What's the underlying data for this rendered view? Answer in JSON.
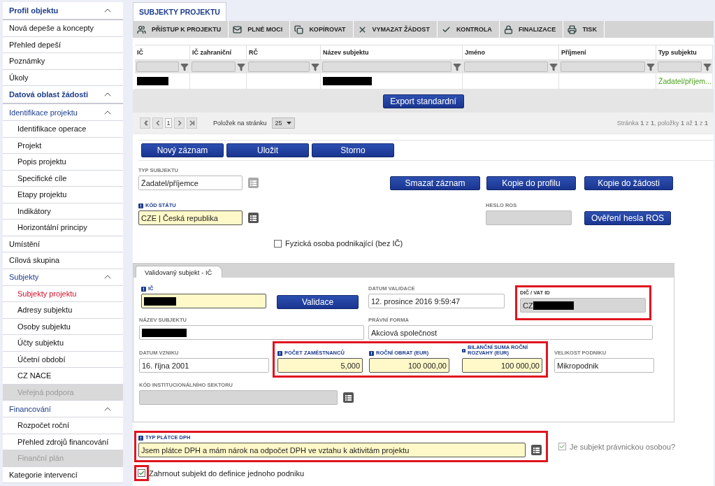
{
  "sidebar": {
    "items": [
      {
        "kind": "header",
        "label": "Profil objektu",
        "expanded": true
      },
      {
        "kind": "link",
        "label": "Nová depeše a koncepty",
        "selected": false,
        "disabled": false
      },
      {
        "kind": "link",
        "label": "Přehled depeší",
        "selected": false,
        "disabled": false
      },
      {
        "kind": "link",
        "label": "Poznámky",
        "selected": false,
        "disabled": false
      },
      {
        "kind": "link",
        "label": "Úkoly",
        "selected": false,
        "disabled": false
      },
      {
        "kind": "header",
        "label": "Datová oblast žádosti",
        "expanded": true
      },
      {
        "kind": "group",
        "label": "Identifikace projektu",
        "expanded": true,
        "children": [
          {
            "label": "Identifikace operace",
            "selected": false,
            "disabled": false
          },
          {
            "label": "Projekt",
            "selected": false,
            "disabled": false
          },
          {
            "label": "Popis projektu",
            "selected": false,
            "disabled": false
          },
          {
            "label": "Specifické cíle",
            "selected": false,
            "disabled": false
          },
          {
            "label": "Etapy projektu",
            "selected": false,
            "disabled": false
          },
          {
            "label": "Indikátory",
            "selected": false,
            "disabled": false
          },
          {
            "label": "Horizontální principy",
            "selected": false,
            "disabled": false
          }
        ]
      },
      {
        "kind": "link",
        "label": "Umístění",
        "selected": false,
        "disabled": false
      },
      {
        "kind": "link",
        "label": "Cílová skupina",
        "selected": false,
        "disabled": false
      },
      {
        "kind": "group",
        "label": "Subjekty",
        "expanded": true,
        "children": [
          {
            "label": "Subjekty projektu",
            "selected": true,
            "disabled": false
          },
          {
            "label": "Adresy subjektu",
            "selected": false,
            "disabled": false
          },
          {
            "label": "Osoby subjektu",
            "selected": false,
            "disabled": false
          },
          {
            "label": "Účty subjektu",
            "selected": false,
            "disabled": false
          },
          {
            "label": "Účetní období",
            "selected": false,
            "disabled": false
          },
          {
            "label": "CZ NACE",
            "selected": false,
            "disabled": false
          },
          {
            "label": "Veřejná podpora",
            "selected": false,
            "disabled": true
          }
        ]
      },
      {
        "kind": "group",
        "label": "Financování",
        "expanded": true,
        "children": [
          {
            "label": "Rozpočet roční",
            "selected": false,
            "disabled": false
          },
          {
            "label": "Přehled zdrojů financování",
            "selected": false,
            "disabled": false
          },
          {
            "label": "Finanční plán",
            "selected": false,
            "disabled": true
          }
        ]
      },
      {
        "kind": "link",
        "label": "Kategorie intervencí",
        "selected": false,
        "disabled": false
      }
    ]
  },
  "page_tab": {
    "label": "SUBJEKTY PROJEKTU",
    "selected": true
  },
  "toolbar": [
    "PŘÍSTUP K PROJEKTU",
    "PLNÉ MOCI",
    "KOPÍROVAT",
    "VYMAZAT ŽÁDOST",
    "KONTROLA",
    "FINALIZACE",
    "TISK"
  ],
  "table": {
    "columns": [
      "IČ",
      "IČ zahraniční",
      "RČ",
      "Název subjektu",
      "Jméno",
      "Příjmení",
      "Typ subjektu"
    ],
    "rows": [
      {
        "cells": [
          {
            "redacted": true
          },
          {
            "redacted": false
          },
          {
            "redacted": false
          },
          {
            "redacted": true
          },
          {
            "redacted": false
          },
          {
            "redacted": false
          },
          {
            "redacted": false,
            "text": "Žadatel/příjem..."
          }
        ]
      }
    ],
    "export_button": "Export standardní",
    "pager": {
      "page": "1",
      "page_size_label": "Položek na stránku",
      "page_size": "25",
      "summary": "Stránka **1** z **1**, položky **1** až **1** z **1**"
    }
  },
  "form": {
    "actions": [
      "Nový záznam",
      "Uložit",
      "Storno"
    ],
    "typ_subjektu": {
      "label": "TYP SUBJEKTU",
      "value": "Žadatel/příjemce",
      "required": false,
      "readonly": false,
      "picker_disabled": true
    },
    "record_actions": [
      "Smazat záznam",
      "Kopie do profilu",
      "Kopie do žádosti"
    ],
    "kod_statu": {
      "label": "KÓD STÁTU",
      "value": "CZE | Česká republika",
      "required": true,
      "readonly": false,
      "picker_disabled": false
    },
    "heslo_ros": {
      "label": "HESLO ROS",
      "required": false,
      "readonly": true
    },
    "verify_button": "Ověření hesla ROS",
    "natural_person": {
      "label": "Fyzická osoba podnikající (bez IČ)",
      "checked": false,
      "disabled": false
    },
    "validated_subject": {
      "tab": "Validovaný subjekt - IČ",
      "ic": {
        "label": "IČ",
        "required": true,
        "readonly": false,
        "redacted": true
      },
      "validate_button": "Validace",
      "datum_validace": {
        "label": "DATUM VALIDACE",
        "value": "12. prosince 2016 9:59:47",
        "required": false,
        "readonly": false
      },
      "dic": {
        "label": "DIČ / VAT ID",
        "value": "CZ",
        "required": false,
        "readonly": true,
        "redacted": true,
        "highlighted": true
      },
      "nazev_subjektu": {
        "label": "NÁZEV SUBJEKTU",
        "required": false,
        "readonly": false,
        "redacted": true
      },
      "pravni_forma": {
        "label": "PRÁVNÍ FORMA",
        "value": "Akciová společnost",
        "required": false,
        "readonly": false
      },
      "datum_vzniku": {
        "label": "DATUM VZNIKU",
        "value": "16. října 2001",
        "required": false,
        "readonly": false
      },
      "size_figures": {
        "highlighted": true,
        "fields": [
          {
            "label": "POČET ZAMĚSTNANCŮ",
            "value": "5,000",
            "required": true,
            "readonly": false
          },
          {
            "label": "ROČNÍ OBRAT (EUR)",
            "value": "100 000,00",
            "required": true,
            "readonly": false
          },
          {
            "label": "BILANČNÍ SUMA ROČNÍ ROZVAHY (EUR)",
            "value": "100 000,00",
            "required": true,
            "readonly": false
          }
        ]
      },
      "velikost_podniku": {
        "label": "VELIKOST PODNIKU",
        "value": "Mikropodnik",
        "required": false,
        "readonly": false
      },
      "kod_sektoru": {
        "label": "KÓD INSTITUCIONÁLNÍHO SEKTORU",
        "required": false,
        "readonly": true,
        "picker_disabled": false
      }
    },
    "typ_platce_dph": {
      "label": "TYP PLÁTCE DPH",
      "value": "Jsem plátce DPH a mám nárok na odpočet DPH ve vztahu k aktivitám projektu",
      "required": true,
      "readonly": false,
      "highlighted": true,
      "picker_disabled": false
    },
    "legal_person": {
      "label": "Je subjekt právnickou osobou?",
      "checked": true,
      "disabled": true
    },
    "single_enterprise": {
      "label": "Zahrnout subjekt do definice jednoho podniku",
      "checked": true,
      "disabled": false,
      "highlighted": true
    }
  }
}
